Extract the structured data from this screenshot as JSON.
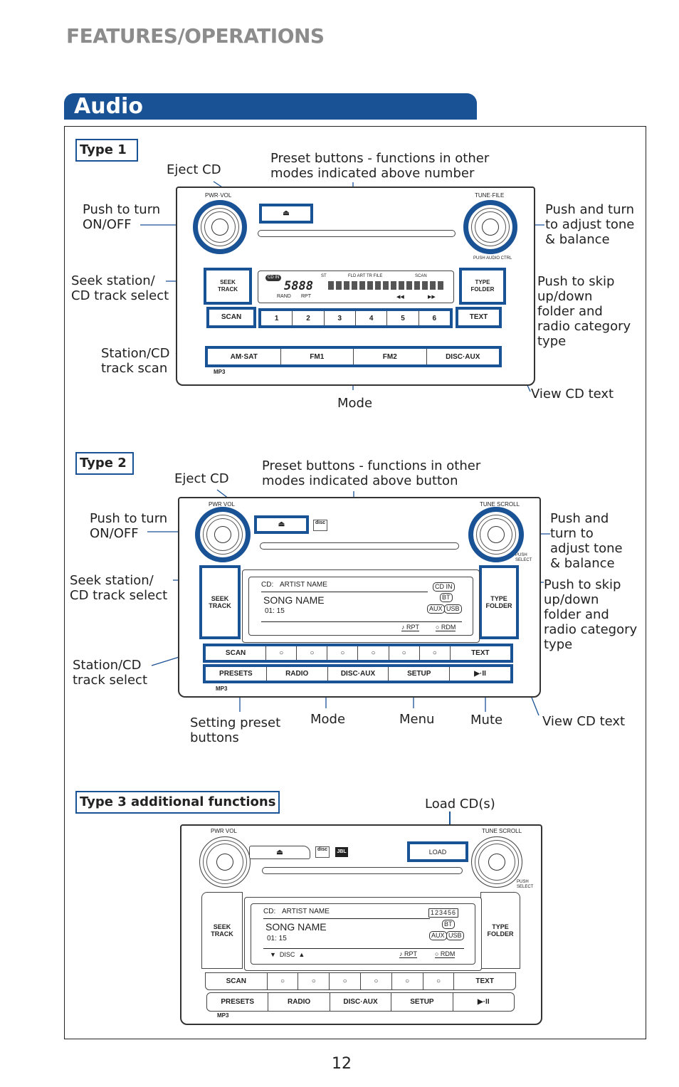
{
  "header": {
    "section": "FEATURES/OPERATIONS",
    "title": "Audio"
  },
  "colors": {
    "accent": "#1a5296",
    "header_gray": "#8c8c8c"
  },
  "type1": {
    "label": "Type 1",
    "callouts": {
      "eject": "Eject CD",
      "presets": "Preset buttons - functions in other\nmodes indicated above number",
      "power": "Push to turn\nON/OFF",
      "tone": "Push and turn\nto adjust tone\n& balance",
      "seek": "Seek station/\nCD track select",
      "skip": "Push to skip\nup/down\nfolder and\nradio category\ntype",
      "scan": "Station/CD\ntrack scan",
      "mode": "Mode",
      "text": "View CD text"
    },
    "radio": {
      "left_knob": "PWR·VOL",
      "right_knob": "TUNE·FILE",
      "push": "PUSH AUDIO CTRL",
      "seek": "SEEK\nTRACK",
      "folder": "TYPE\nFOLDER",
      "scan": "SCAN",
      "text": "TEXT",
      "presets": [
        "1",
        "2",
        "3",
        "4",
        "5",
        "6"
      ],
      "modes": [
        "AM·SAT",
        "FM1",
        "FM2",
        "DISC·AUX"
      ],
      "mp3": "MP3",
      "display": {
        "cd_in": "CD IN",
        "digits": "5888",
        "st": "ST",
        "tags": "FLD ART TR FILE",
        "scan": "SCAN",
        "rand": "RAND",
        "rpt": "RPT",
        "rew": "◀◀",
        "ff": "▶▶"
      }
    }
  },
  "type2": {
    "label": "Type 2",
    "callouts": {
      "eject": "Eject CD",
      "presets": "Preset buttons - functions in other\nmodes indicated above button",
      "power": "Push to turn\nON/OFF",
      "tone": "Push and\nturn to\nadjust tone\n& balance",
      "seek": "Seek station/\nCD track select",
      "skip": "Push to skip\nup/down\nfolder and\nradio category\ntype",
      "scan": "Station/CD\ntrack select",
      "setting": "Setting preset\nbuttons",
      "mode": "Mode",
      "menu": "Menu",
      "mute": "Mute",
      "text": "View CD text"
    },
    "radio": {
      "left_knob": "PWR VOL",
      "right_knob": "TUNE SCROLL",
      "push": "PUSH\nSELECT",
      "seek": "SEEK\nTRACK",
      "folder": "TYPE\nFOLDER",
      "scan": "SCAN",
      "text": "TEXT",
      "presets": [
        "○",
        "○",
        "○",
        "○",
        "○",
        "○"
      ],
      "modes": [
        "PRESETS",
        "RADIO",
        "DISC·AUX",
        "SETUP",
        "▶·II"
      ],
      "mp3": "MP3",
      "display": {
        "source": "CD:",
        "artist": "ARTIST NAME",
        "song": "SONG NAME",
        "time": "01: 15",
        "cd_in": "CD IN",
        "bt": "BT",
        "aux": "AUX",
        "usb": "USB",
        "rpt": "♪ RPT",
        "rdm": "○ RDM"
      }
    }
  },
  "type3": {
    "label": "Type 3 additional functions",
    "callouts": {
      "load": "Load CD(s)"
    },
    "radio": {
      "left_knob": "PWR VOL",
      "right_knob": "TUNE SCROLL",
      "push": "PUSH\nSELECT",
      "load": "LOAD",
      "jbl": "JBL",
      "seek": "SEEK\nTRACK",
      "folder": "TYPE\nFOLDER",
      "scan": "SCAN",
      "text": "TEXT",
      "presets": [
        "○",
        "○",
        "○",
        "○",
        "○",
        "○"
      ],
      "modes": [
        "PRESETS",
        "RADIO",
        "DISC·AUX",
        "SETUP",
        "▶·II"
      ],
      "mp3": "MP3",
      "display": {
        "source": "CD:",
        "artist": "ARTIST NAME",
        "song": "SONG NAME",
        "time": "01: 15",
        "discs": "123456",
        "bt": "BT",
        "aux": "AUX",
        "usb": "USB",
        "disc": "▼  DISC  ▲",
        "rpt": "♪ RPT",
        "rdm": "○ RDM"
      }
    }
  },
  "page_number": "12"
}
